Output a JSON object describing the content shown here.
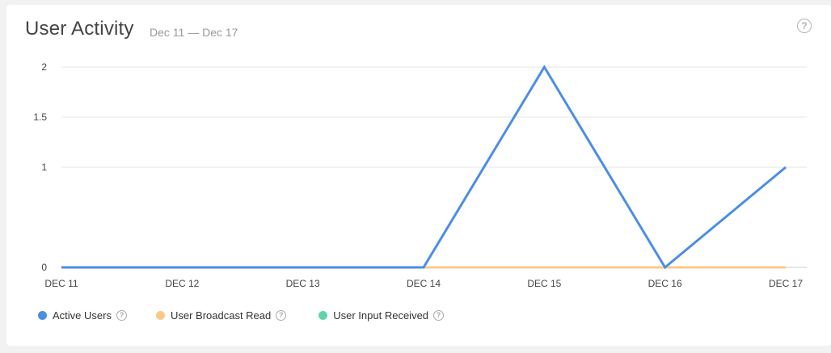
{
  "header": {
    "title": "User Activity",
    "date_range": "Dec 11 — Dec 17",
    "help_icon": "question-circle-icon"
  },
  "colors": {
    "active_users": "#4a8ee6",
    "user_broadcast_read": "#f9c98a",
    "user_input_received": "#5fd3b0",
    "grid": "#e6e6e6",
    "axis_text": "#444444"
  },
  "chart_data": {
    "type": "line",
    "title": "User Activity",
    "subtitle": "Dec 11 — Dec 17",
    "xlabel": "",
    "ylabel": "",
    "x": [
      "DEC 11",
      "DEC 12",
      "DEC 13",
      "DEC 14",
      "DEC 15",
      "DEC 16",
      "DEC 17"
    ],
    "y_ticks": [
      0,
      1,
      1.5,
      2
    ],
    "y_tick_labels": [
      "0",
      "1",
      "1.5",
      "2"
    ],
    "ylim": [
      0,
      2
    ],
    "grid": true,
    "legend_position": "bottom-left",
    "series": [
      {
        "name": "Active Users",
        "key": "active_users",
        "values": [
          0,
          0,
          0,
          0,
          2,
          0,
          1
        ]
      },
      {
        "name": "User Broadcast Read",
        "key": "user_broadcast_read",
        "values": [
          null,
          null,
          null,
          0,
          0,
          0,
          0
        ]
      },
      {
        "name": "User Input Received",
        "key": "user_input_received",
        "values": []
      }
    ]
  }
}
